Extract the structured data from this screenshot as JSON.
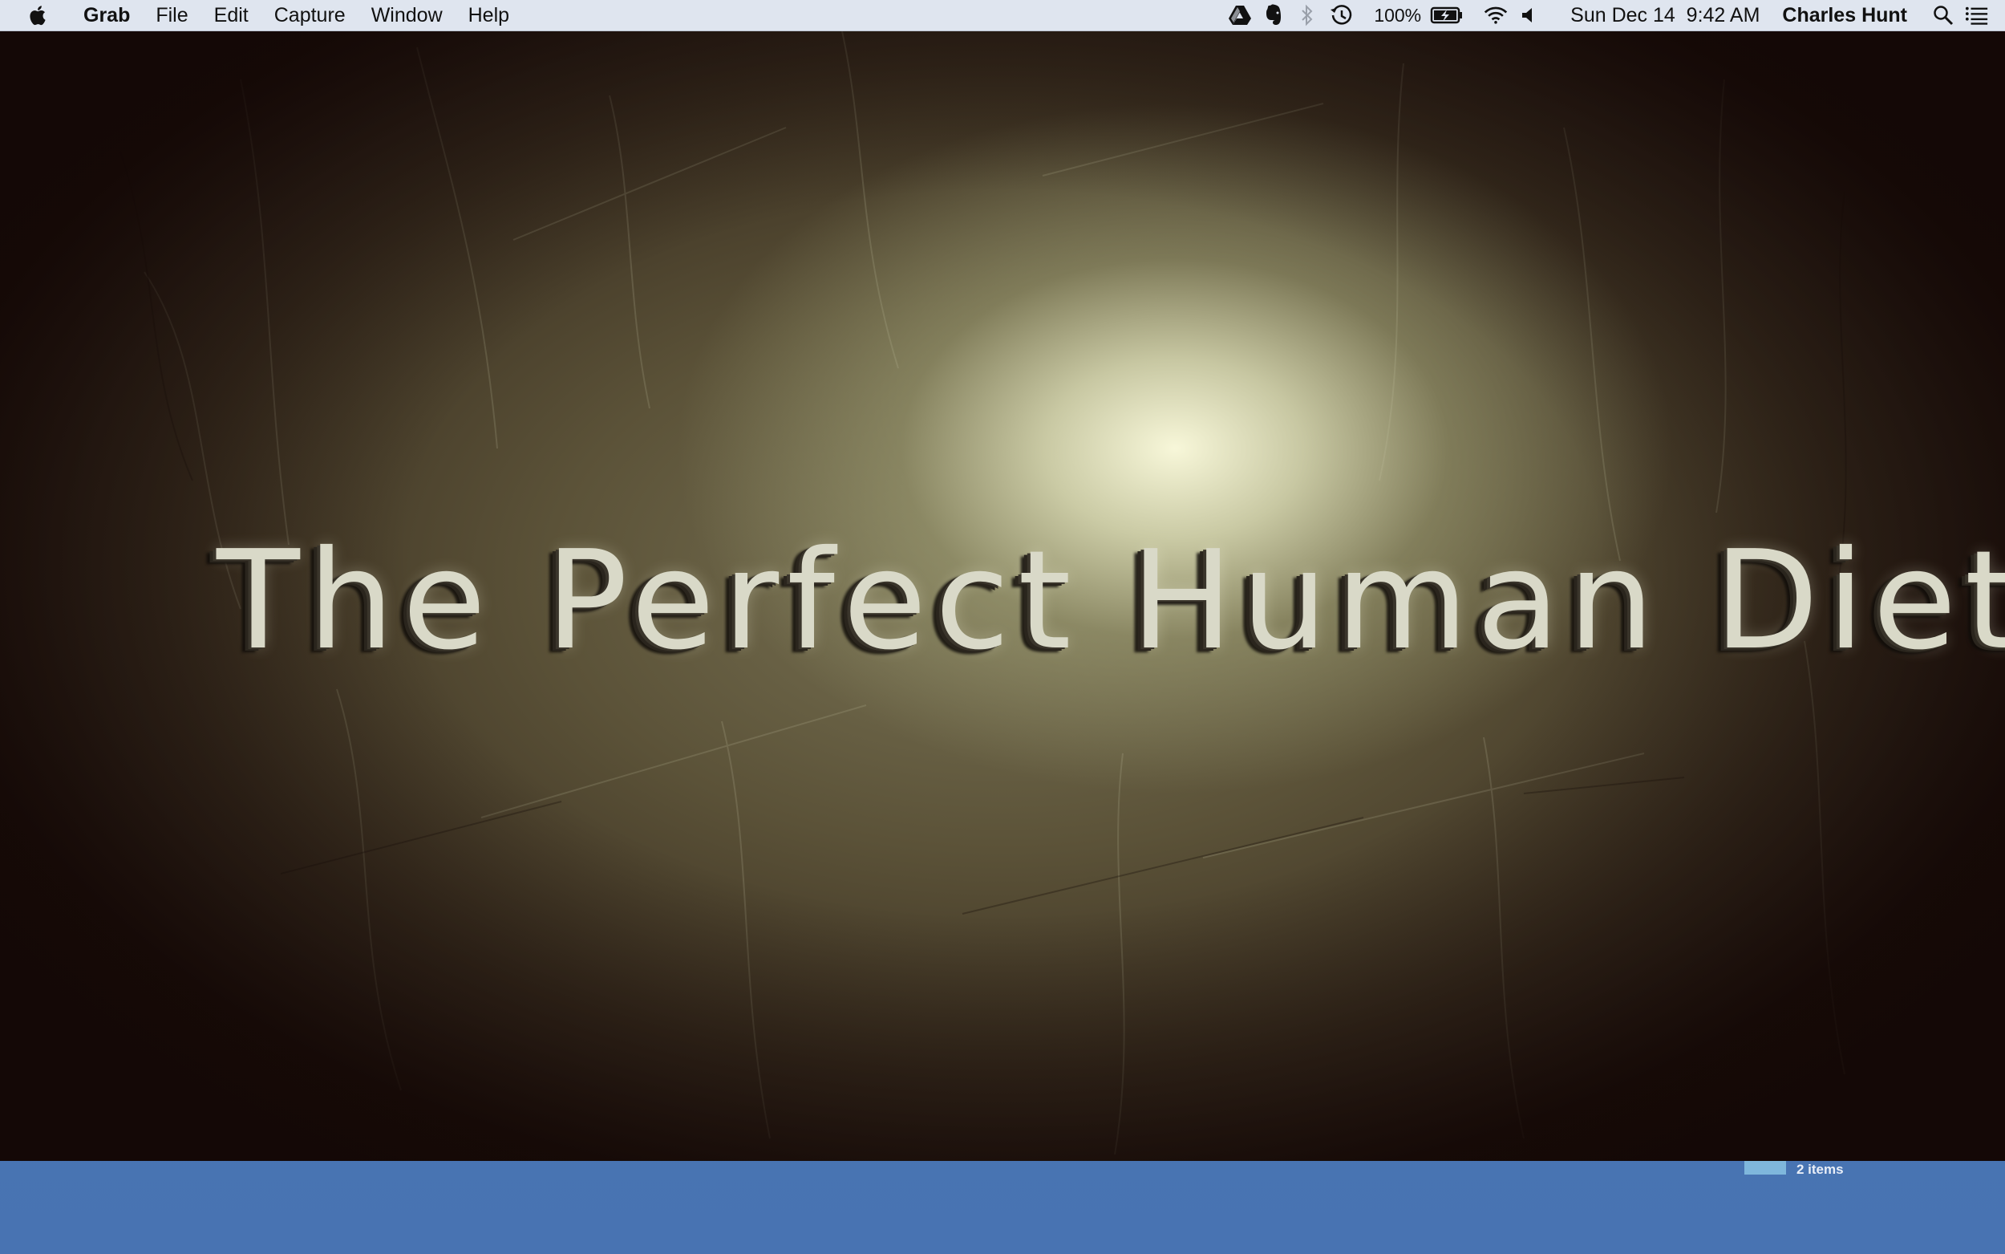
{
  "menubar": {
    "app_name": "Grab",
    "menus": [
      "File",
      "Edit",
      "Capture",
      "Window",
      "Help"
    ],
    "status": {
      "icons": [
        "google-drive-icon",
        "evernote-icon",
        "bluetooth-icon",
        "time-machine-icon"
      ],
      "battery_percent": "100%",
      "date_time": "Sun Dec 14  9:42 AM",
      "user_name": "Charles Hunt"
    }
  },
  "video": {
    "title_text": "The Perfect Human Diet"
  },
  "desktop": {
    "item_count": "2 items"
  },
  "colors": {
    "menubar_bg": "#dfe5ef",
    "desktop_bg": "#4a76b5",
    "title_text": "#d9d9c8"
  }
}
